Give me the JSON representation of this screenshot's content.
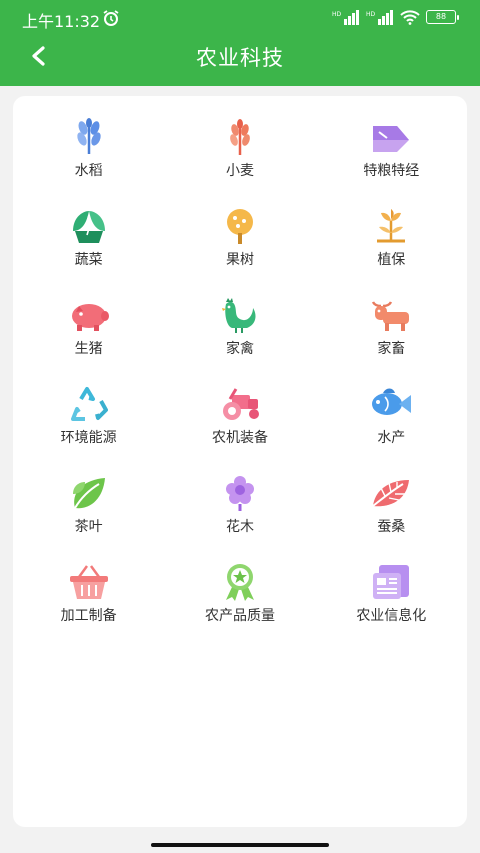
{
  "status": {
    "time": "上午11:32",
    "battery": "88"
  },
  "header": {
    "title": "农业科技"
  },
  "colors": {
    "primary": "#3cb54a"
  },
  "categories": [
    {
      "label": "水稻",
      "icon": "rice-icon"
    },
    {
      "label": "小麦",
      "icon": "wheat-icon"
    },
    {
      "label": "特粮特经",
      "icon": "special-crop-icon"
    },
    {
      "label": "蔬菜",
      "icon": "vegetable-icon"
    },
    {
      "label": "果树",
      "icon": "fruit-tree-icon"
    },
    {
      "label": "植保",
      "icon": "plant-protection-icon"
    },
    {
      "label": "生猪",
      "icon": "pig-icon"
    },
    {
      "label": "家禽",
      "icon": "rooster-icon"
    },
    {
      "label": "家畜",
      "icon": "cattle-icon"
    },
    {
      "label": "环境能源",
      "icon": "recycle-icon"
    },
    {
      "label": "农机装备",
      "icon": "tractor-icon"
    },
    {
      "label": "水产",
      "icon": "fish-icon"
    },
    {
      "label": "茶叶",
      "icon": "tea-leaf-icon"
    },
    {
      "label": "花木",
      "icon": "flower-icon"
    },
    {
      "label": "蚕桑",
      "icon": "mulberry-leaf-icon"
    },
    {
      "label": "加工制备",
      "icon": "basket-icon"
    },
    {
      "label": "农产品质量",
      "icon": "quality-badge-icon"
    },
    {
      "label": "农业信息化",
      "icon": "info-document-icon"
    }
  ]
}
